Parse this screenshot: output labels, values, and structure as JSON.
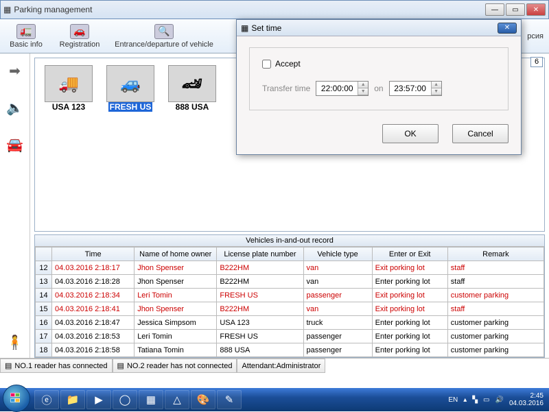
{
  "window": {
    "title": "Parking management"
  },
  "toolbar": {
    "basic_info": "Basic info",
    "registration": "Registration",
    "entrance": "Entrance/departure of vehicle",
    "rsia": "рсия"
  },
  "page_indicator": "6",
  "thumbs": [
    {
      "label": "USA 123",
      "glyph": "🚚"
    },
    {
      "label": "FRESH US",
      "glyph": "🚙",
      "selected": true
    },
    {
      "label": "888 USA",
      "glyph": "🏎"
    }
  ],
  "table": {
    "title": "Vehicles in-and-out record",
    "headers": {
      "time": "Time",
      "owner": "Name of home owner",
      "plate": "License plate number",
      "type": "Vehicle type",
      "enter": "Enter or Exit",
      "remark": "Remark"
    },
    "rows": [
      {
        "n": "12",
        "time": "04.03.2016 2:18:17",
        "owner": "Jhon Spenser",
        "plate": "B222HM",
        "type": "van",
        "enter": "Exit porking lot",
        "remark": "staff",
        "red": true
      },
      {
        "n": "13",
        "time": "04.03.2016 2:18:28",
        "owner": "Jhon Spenser",
        "plate": "B222HM",
        "type": "van",
        "enter": "Enter porking lot",
        "remark": "staff",
        "red": false
      },
      {
        "n": "14",
        "time": "04.03.2016 2:18:34",
        "owner": "Leri Tomin",
        "plate": "FRESH US",
        "type": "passenger",
        "enter": "Exit porking lot",
        "remark": "customer parking",
        "red": true
      },
      {
        "n": "15",
        "time": "04.03.2016 2:18:41",
        "owner": "Jhon Spenser",
        "plate": "B222HM",
        "type": "van",
        "enter": "Exit porking lot",
        "remark": "staff",
        "red": true
      },
      {
        "n": "16",
        "time": "04.03.2016 2:18:47",
        "owner": "Jessica Simpsom",
        "plate": "USA 123",
        "type": "truck",
        "enter": "Enter porking lot",
        "remark": "customer parking",
        "red": false
      },
      {
        "n": "17",
        "time": "04.03.2016 2:18:53",
        "owner": "Leri Tomin",
        "plate": "FRESH US",
        "type": "passenger",
        "enter": "Enter porking lot",
        "remark": "customer parking",
        "red": false
      },
      {
        "n": "18",
        "time": "04.03.2016 2:18:58",
        "owner": "Tatiana Tomin",
        "plate": "888 USA",
        "type": "passenger",
        "enter": "Enter porking lot",
        "remark": "customer parking",
        "red": false
      }
    ]
  },
  "status": {
    "reader1": "NO.1 reader has connected",
    "reader2": "NO.2 reader has not connected",
    "attendant": "Attendant:Administrator"
  },
  "modal": {
    "title": "Set time",
    "accept": "Accept",
    "transfer_label": "Transfer time",
    "time1": "22:00:00",
    "on_label": "on",
    "time2": "23:57:00",
    "ok": "OK",
    "cancel": "Cancel"
  },
  "taskbar": {
    "lang": "EN",
    "time": "2:45",
    "date": "04.03.2016"
  }
}
